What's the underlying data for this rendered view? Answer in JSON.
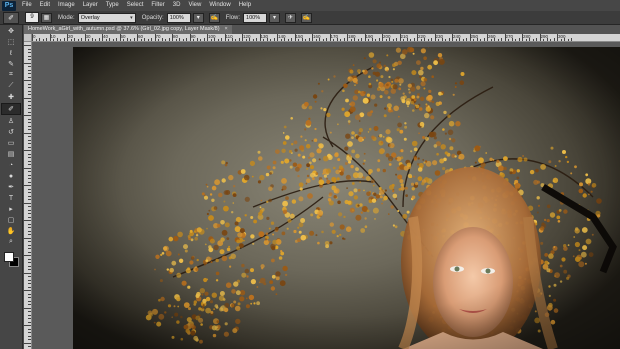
{
  "app": {
    "logo": "Ps"
  },
  "menu": [
    "File",
    "Edit",
    "Image",
    "Layer",
    "Type",
    "Select",
    "Filter",
    "3D",
    "View",
    "Window",
    "Help"
  ],
  "options_bar": {
    "brush_size": "9",
    "mode_label": "Mode:",
    "mode_value": "Overlay",
    "opacity_label": "Opacity:",
    "opacity_value": "100%",
    "flow_label": "Flow:",
    "flow_value": "100%"
  },
  "document_tab": {
    "title": "HomeWork_aGirl_with_autumn.psd @ 37.6% (Girl_02.jpg copy, Layer Mask/8)",
    "close": "×"
  },
  "ruler": {
    "top_labels": [
      "0",
      "10",
      "20",
      "30",
      "40",
      "50",
      "60",
      "70",
      "80",
      "90",
      "100",
      "110",
      "120",
      "130",
      "140",
      "150",
      "160",
      "170",
      "180",
      "190",
      "200",
      "210",
      "220",
      "230",
      "240",
      "250",
      "260",
      "270",
      "280",
      "290",
      "300"
    ]
  },
  "tools": [
    {
      "name": "move-tool",
      "glyph": "✥"
    },
    {
      "name": "marquee-tool",
      "glyph": "⬚"
    },
    {
      "name": "lasso-tool",
      "glyph": "ℓ"
    },
    {
      "name": "quick-select-tool",
      "glyph": "✎"
    },
    {
      "name": "crop-tool",
      "glyph": "⌗"
    },
    {
      "name": "eyedropper-tool",
      "glyph": "⟋"
    },
    {
      "name": "healing-brush-tool",
      "glyph": "✚"
    },
    {
      "name": "brush-tool",
      "glyph": "✐",
      "active": true
    },
    {
      "name": "clone-stamp-tool",
      "glyph": "♙"
    },
    {
      "name": "history-brush-tool",
      "glyph": "↺"
    },
    {
      "name": "eraser-tool",
      "glyph": "▭"
    },
    {
      "name": "gradient-tool",
      "glyph": "▤"
    },
    {
      "name": "blur-tool",
      "glyph": "◔"
    },
    {
      "name": "dodge-tool",
      "glyph": "●"
    },
    {
      "name": "pen-tool",
      "glyph": "✒"
    },
    {
      "name": "type-tool",
      "glyph": "T"
    },
    {
      "name": "path-select-tool",
      "glyph": "▸"
    },
    {
      "name": "shape-tool",
      "glyph": "▢"
    },
    {
      "name": "hand-tool",
      "glyph": "✋"
    },
    {
      "name": "zoom-tool",
      "glyph": "⌕"
    }
  ],
  "colors": {
    "foreground": "#ffffff",
    "background": "#000000"
  }
}
